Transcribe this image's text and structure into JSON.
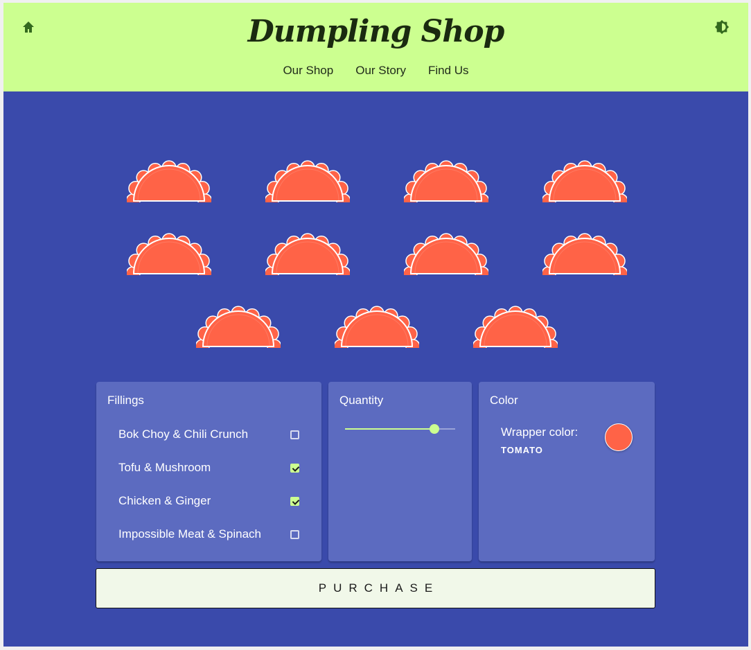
{
  "header": {
    "title": "Dumpling Shop",
    "home_icon": "home-icon",
    "theme_icon": "brightness-contrast-icon",
    "nav": [
      "Our Shop",
      "Our Story",
      "Find Us"
    ],
    "background": "#ccff90"
  },
  "dumplings": {
    "count": 11,
    "icon": "dumpling-icon",
    "wrapper_color": "#ff6347"
  },
  "fillings": {
    "title": "Fillings",
    "items": [
      {
        "label": "Bok Choy & Chili Crunch",
        "checked": false
      },
      {
        "label": "Tofu & Mushroom",
        "checked": true
      },
      {
        "label": "Chicken & Ginger",
        "checked": true
      },
      {
        "label": "Impossible Meat & Spinach",
        "checked": false
      }
    ]
  },
  "quantity": {
    "title": "Quantity",
    "value": 11,
    "slider_fraction": 0.84
  },
  "color": {
    "title": "Color",
    "wrapper_label": "Wrapper color:",
    "wrapper_value": "TOMATO",
    "swatch": "#ff6347"
  },
  "purchase": {
    "label": "PURCHASE"
  },
  "theme": {
    "page_bg": "#3a4aab",
    "panel_bg": "#5c6bc0",
    "accent": "#ccff90"
  }
}
